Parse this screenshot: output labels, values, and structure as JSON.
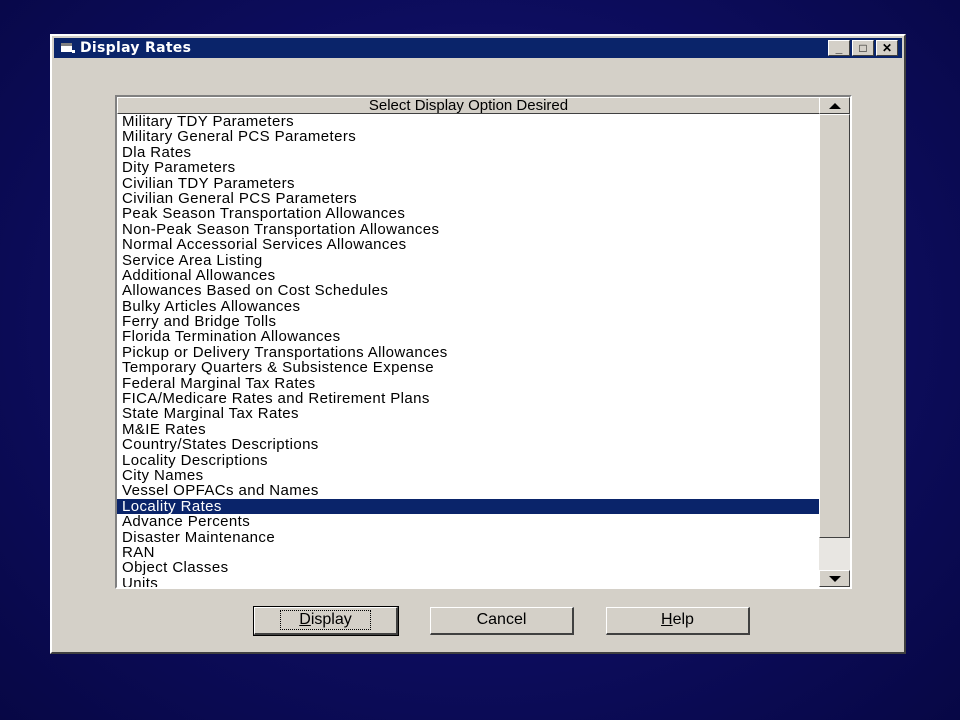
{
  "window": {
    "title": "Display Rates",
    "controls": {
      "minimize": "_",
      "maximize": "□",
      "close": "✕"
    }
  },
  "list": {
    "header": "Select Display Option Desired",
    "items": [
      "Military TDY Parameters",
      "Military General PCS Parameters",
      "Dla Rates",
      "Dity Parameters",
      "Civilian TDY Parameters",
      "Civilian General PCS Parameters",
      "Peak Season Transportation Allowances",
      "Non-Peak Season Transportation Allowances",
      "Normal Accessorial Services Allowances",
      "Service Area Listing",
      "Additional Allowances",
      "Allowances Based on Cost Schedules",
      "Bulky Articles Allowances",
      "Ferry and Bridge Tolls",
      "Florida Termination Allowances",
      "Pickup or Delivery Transportations Allowances",
      "Temporary Quarters & Subsistence Expense",
      "Federal Marginal Tax Rates",
      "FICA/Medicare Rates and Retirement Plans",
      "State Marginal Tax Rates",
      "M&IE Rates",
      "Country/States Descriptions",
      "Locality Descriptions",
      "City Names",
      "Vessel OPFACs and Names",
      "Locality Rates",
      "Advance Percents",
      "Disaster Maintenance",
      "RAN",
      "Object Classes",
      "Units"
    ],
    "selected_index": 25
  },
  "buttons": {
    "display": {
      "accel": "D",
      "rest": "isplay"
    },
    "cancel": "Cancel",
    "help": {
      "accel": "H",
      "rest": "elp"
    }
  },
  "colors": {
    "selection": "#0a246a",
    "titlebar": "#0a246a",
    "dialog": "#d4d0c8",
    "background": "#0d0d5e"
  }
}
